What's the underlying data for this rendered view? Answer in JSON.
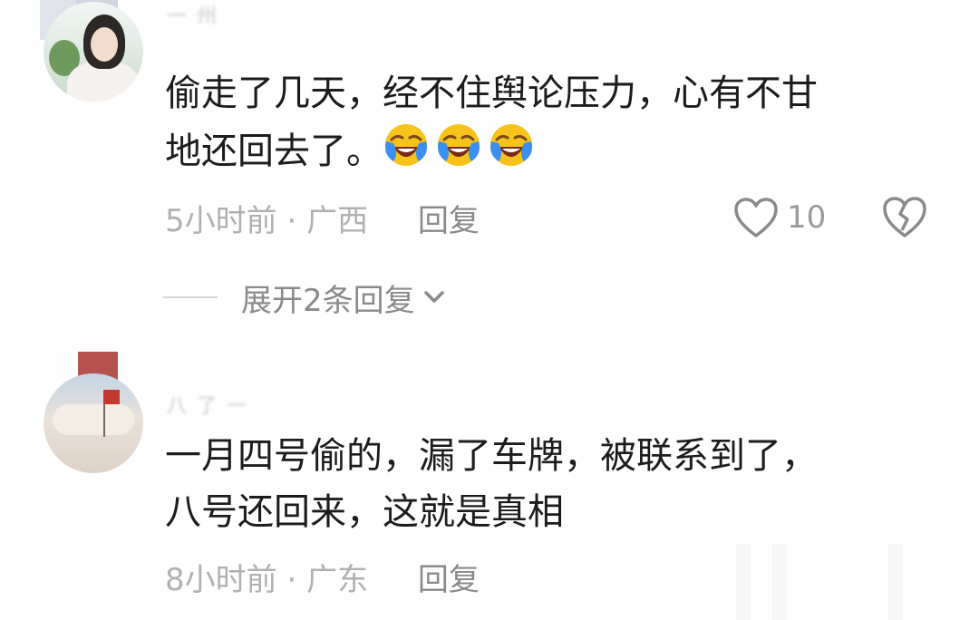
{
  "comments": [
    {
      "username": "一 州",
      "text_line1": "偷走了几天，经不住舆论压力，心有不甘",
      "text_line2": "地还回去了。",
      "emojis": [
        "laughing-crying-emoji",
        "laughing-crying-emoji",
        "laughing-crying-emoji"
      ],
      "time": "5小时前",
      "separator": "·",
      "location": "广西",
      "reply_label": "回复",
      "like_count": "10",
      "expand_label": "展开2条回复"
    },
    {
      "username": "八 了 一",
      "text_line1": "一月四号偷的，漏了车牌，被联系到了，",
      "text_line2": "八号还回来，这就是真相",
      "time": "8小时前",
      "separator": "·",
      "location": "广东",
      "reply_label": "回复"
    }
  ],
  "colors": {
    "text": "#1c1c1c",
    "meta": "#b0b0b0",
    "action": "#8a8a8a",
    "emoji_yellow": "#f7c31a",
    "emoji_blue": "#3b8ff0"
  }
}
